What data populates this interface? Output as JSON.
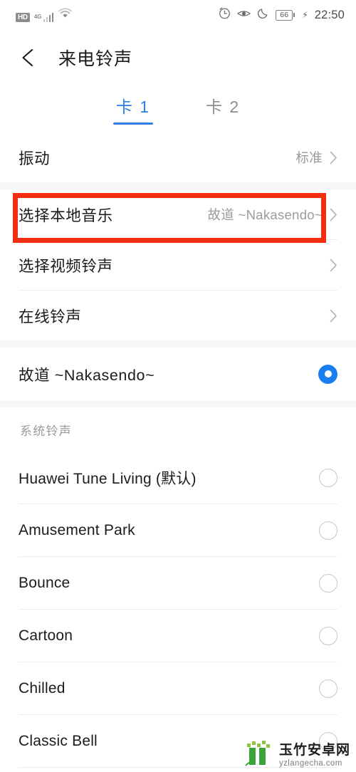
{
  "status_bar": {
    "hd_label": "HD",
    "network_label": "4G",
    "signal_icon": "signal-bars-icon",
    "wifi_icon": "wifi-icon",
    "alarm_icon": "alarm-icon",
    "eye_icon": "eye-comfort-icon",
    "moon_icon": "do-not-disturb-moon-icon",
    "battery_level": "66",
    "charging_icon": "charging-bolt-icon",
    "time": "22:50"
  },
  "header": {
    "back_icon": "back-arrow-icon",
    "title": "来电铃声"
  },
  "tabs": [
    {
      "label": "卡 1",
      "active": true
    },
    {
      "label": "卡 2",
      "active": false
    }
  ],
  "vibrate_row": {
    "label": "振动",
    "value": "标准",
    "chevron_icon": "chevron-right-icon"
  },
  "source_rows": [
    {
      "label": "选择本地音乐",
      "value": "故道 ~Nakasendo~",
      "chevron_icon": "chevron-right-icon",
      "highlighted": false
    },
    {
      "label": "选择视频铃声",
      "value": "",
      "chevron_icon": "chevron-right-icon",
      "highlighted": true
    },
    {
      "label": "在线铃声",
      "value": "",
      "chevron_icon": "chevron-right-icon",
      "highlighted": false
    }
  ],
  "selected_ringtone": {
    "label": "故道 ~Nakasendo~",
    "radio_icon": "radio-selected-icon",
    "selected": true
  },
  "system_section": {
    "title": "系统铃声",
    "items": [
      {
        "label": "Huawei Tune Living (默认)",
        "selected": false
      },
      {
        "label": "Amusement Park",
        "selected": false
      },
      {
        "label": "Bounce",
        "selected": false
      },
      {
        "label": "Cartoon",
        "selected": false
      },
      {
        "label": "Chilled",
        "selected": false
      },
      {
        "label": "Classic Bell",
        "selected": false
      }
    ],
    "radio_icon": "radio-unselected-icon"
  },
  "watermark": {
    "logo_icon": "bamboo-logo-icon",
    "site_name": "玉竹安卓网",
    "site_url": "yzlangecha.com"
  },
  "colors": {
    "accent_blue": "#2c7fe0",
    "radio_blue": "#1a7ef0",
    "annotation_red": "#f22d10",
    "divider": "#ececec",
    "section_gap": "#f6f6f7"
  }
}
